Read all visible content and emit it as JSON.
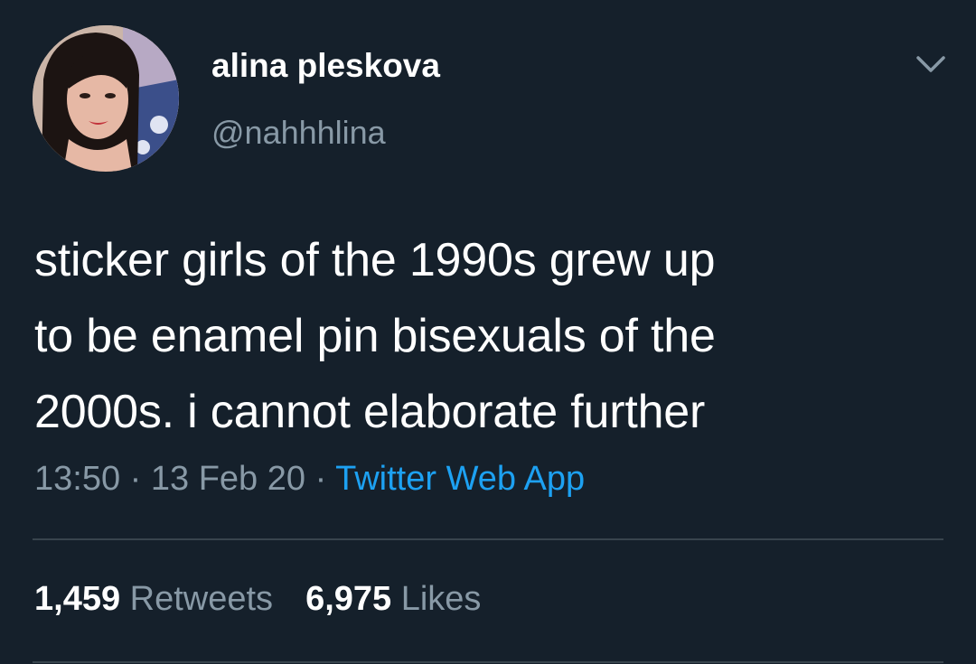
{
  "user": {
    "display_name": "alina pleskova",
    "handle": "@nahhhlina"
  },
  "tweet": {
    "lines": [
      "sticker girls of the 1990s grew up",
      "to be enamel pin bisexuals of the",
      "2000s. i cannot elaborate further"
    ],
    "time": "13:50",
    "separator1": " · ",
    "date": "13 Feb 20",
    "separator2": " · ",
    "source": "Twitter Web App"
  },
  "stats": {
    "retweets_count": "1,459",
    "retweets_label": "Retweets",
    "likes_count": "6,975",
    "likes_label": "Likes"
  },
  "icons": {
    "menu": "chevron-down-icon"
  },
  "colors": {
    "background": "#15202b",
    "primary_text": "#ffffff",
    "secondary_text": "#8899a6",
    "link": "#1da1f2",
    "divider": "#38444d"
  }
}
